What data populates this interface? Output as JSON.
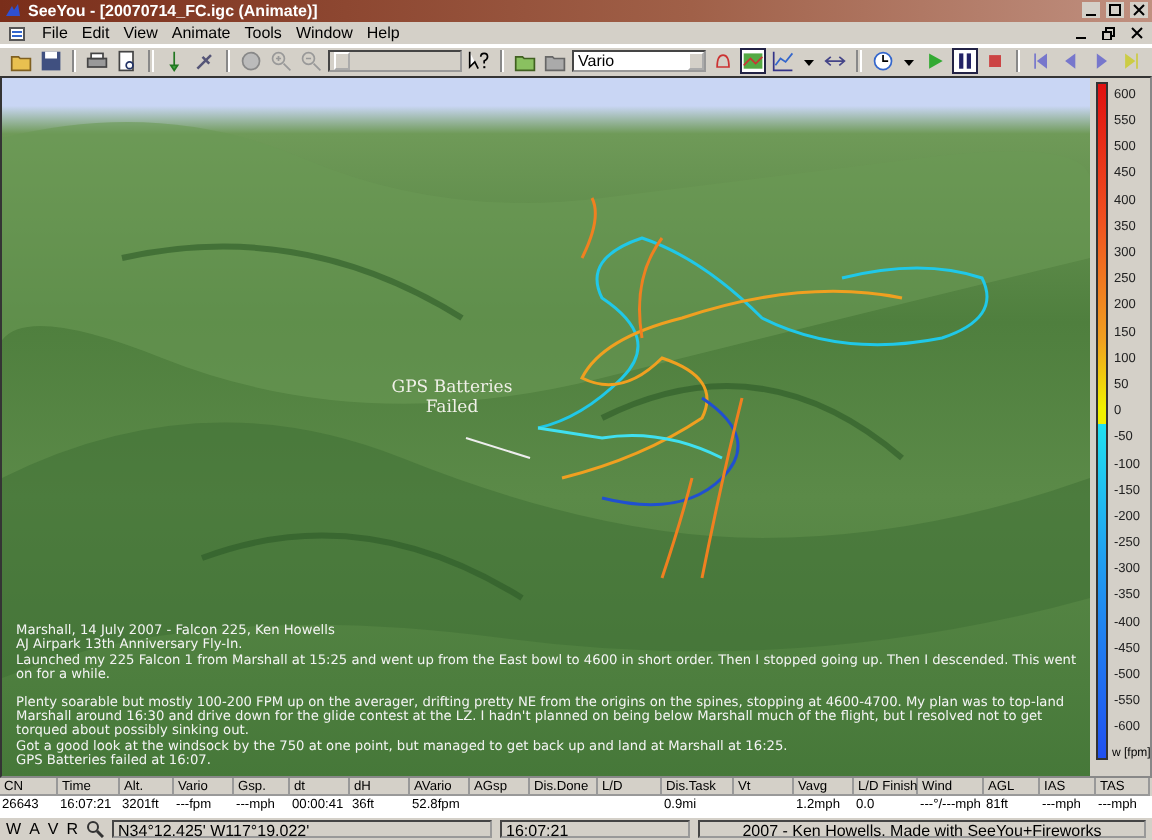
{
  "window": {
    "title": "SeeYou - [20070714_FC.igc (Animate)]"
  },
  "menu": [
    "File",
    "Edit",
    "View",
    "Animate",
    "Tools",
    "Window",
    "Help"
  ],
  "toolbar": {
    "buttons": [
      {
        "kind": "open",
        "pressed": false
      },
      {
        "kind": "save",
        "pressed": false
      },
      {
        "kind": "sep"
      },
      {
        "kind": "print",
        "pressed": false
      },
      {
        "kind": "preview",
        "pressed": false
      },
      {
        "kind": "sep"
      },
      {
        "kind": "pin",
        "pressed": false
      },
      {
        "kind": "satellite",
        "pressed": false
      },
      {
        "kind": "sep"
      },
      {
        "kind": "globe",
        "pressed": false
      },
      {
        "kind": "zoomin",
        "pressed": false
      },
      {
        "kind": "zoomout",
        "pressed": false
      },
      {
        "kind": "zoomcombo"
      },
      {
        "kind": "help",
        "pressed": false
      },
      {
        "kind": "sep"
      },
      {
        "kind": "folder",
        "pressed": false
      },
      {
        "kind": "folder2",
        "pressed": false
      },
      {
        "kind": "varcombo"
      },
      {
        "kind": "bell",
        "pressed": false
      },
      {
        "kind": "map3d",
        "pressed": true
      },
      {
        "kind": "graph",
        "pressed": false
      },
      {
        "kind": "caret",
        "pressed": false
      },
      {
        "kind": "fit",
        "pressed": false
      },
      {
        "kind": "sep"
      },
      {
        "kind": "clock",
        "pressed": false
      },
      {
        "kind": "caret",
        "pressed": false
      },
      {
        "kind": "play",
        "pressed": false
      },
      {
        "kind": "pause",
        "pressed": true
      },
      {
        "kind": "stop",
        "pressed": false
      },
      {
        "kind": "sep"
      },
      {
        "kind": "first",
        "pressed": false
      },
      {
        "kind": "prev",
        "pressed": false
      },
      {
        "kind": "next",
        "pressed": false
      },
      {
        "kind": "last",
        "pressed": false
      }
    ],
    "variable_select": {
      "value": "Vario"
    }
  },
  "view": {
    "annotation": "GPS Batteries Failed",
    "notes": [
      "Marshall, 14 July 2007 - Falcon 225, Ken Howells",
      "AJ Airpark 13th Anniversary Fly-In.",
      "Launched my 225 Falcon 1 from Marshall at 15:25 and went up from the East bowl to 4600 in short order. Then I stopped going up. Then I descended. This went on for a while.",
      "Plenty soarable but mostly 100-200 FPM up on the averager, drifting pretty NE from the origins on the spines, stopping at 4600-4700. My plan was to top-land Marshall around 16:30 and drive down for the glide contest at the LZ. I hadn't planned on being below Marshall much of the flight, but I resolved not to get torqued about possibly sinking out.",
      "Got a good look at the windsock by the 750 at one point, but managed to get back up and land at Marshall at 16:25.",
      "GPS Batteries failed at 16:07."
    ],
    "legend": {
      "ticks": [
        "600",
        "550",
        "500",
        "450",
        "400",
        "350",
        "300",
        "250",
        "200",
        "150",
        "100",
        "50",
        "0",
        "-50",
        "-100",
        "-150",
        "-200",
        "-250",
        "-300",
        "-350",
        "-400",
        "-450",
        "-500",
        "-550",
        "-600"
      ],
      "unit": "w [fpm]"
    }
  },
  "grid": {
    "columns": [
      {
        "label": "CN",
        "value": "26643"
      },
      {
        "label": "Time",
        "value": "16:07:21"
      },
      {
        "label": "Alt.",
        "value": "3201ft"
      },
      {
        "label": "Vario",
        "value": "---fpm"
      },
      {
        "label": "Gsp.",
        "value": "---mph"
      },
      {
        "label": "dt",
        "value": "00:00:41"
      },
      {
        "label": "dH",
        "value": "36ft"
      },
      {
        "label": "AVario",
        "value": "52.8fpm"
      },
      {
        "label": "AGsp"
      },
      {
        "label": "Dis.Done"
      },
      {
        "label": "L/D"
      },
      {
        "label": "Dis.Task",
        "value": "0.9mi"
      },
      {
        "label": "Vt"
      },
      {
        "label": "Vavg",
        "value": "1.2mph"
      },
      {
        "label": "L/D Finish",
        "value": "0.0"
      },
      {
        "label": "Wind",
        "value": "---°/---mph"
      },
      {
        "label": "AGL",
        "value": "81ft"
      },
      {
        "label": "IAS",
        "value": "---mph"
      },
      {
        "label": "TAS",
        "value": "---mph"
      }
    ]
  },
  "status_bar": {
    "modes": [
      "W",
      "A",
      "V",
      "R"
    ],
    "position": "N34°12.425'  W117°19.022'",
    "time": "16:07:21",
    "credit": "2007 - Ken Howells. Made with SeeYou+Fireworks"
  }
}
